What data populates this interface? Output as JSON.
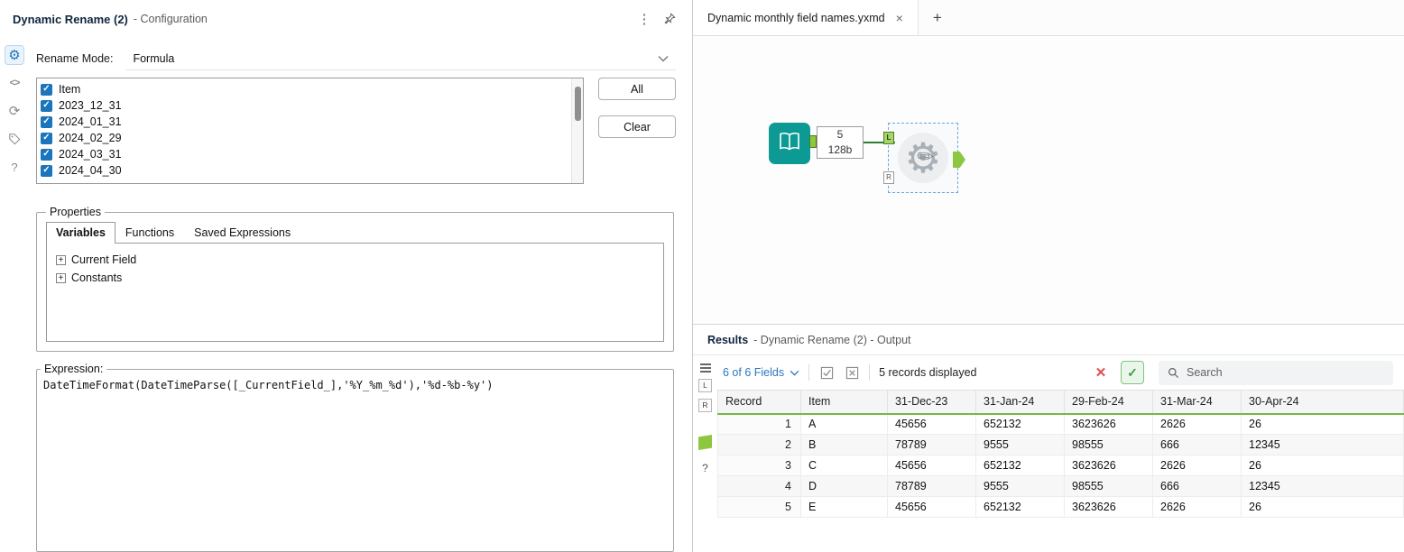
{
  "colors": {
    "accent_blue": "#1c74bc",
    "tool_teal": "#0e9a94",
    "anchor_green": "#8dc63f",
    "connection_green": "#2e7d32",
    "selection_blue": "#6aa7dd",
    "cancel_red": "#e04f4f",
    "run_green": "#3f9c44",
    "title_navy": "#10263f"
  },
  "config": {
    "title": "Dynamic Rename (2)",
    "subtitle": "- Configuration",
    "rename_mode": {
      "label": "Rename Mode:",
      "value": "Formula"
    },
    "fields": [
      "Item",
      "2023_12_31",
      "2024_01_31",
      "2024_02_29",
      "2024_03_31",
      "2024_04_30"
    ],
    "buttons": {
      "all": "All",
      "clear": "Clear"
    },
    "properties": {
      "legend": "Properties",
      "tabs": [
        "Variables",
        "Functions",
        "Saved Expressions"
      ],
      "active_tab": "Variables",
      "tree": [
        "Current Field",
        "Constants"
      ]
    },
    "expression": {
      "legend": "Expression:",
      "value": "DateTimeFormat(DateTimeParse([_CurrentField_],'%Y_%m_%d'),'%d-%b-%y')"
    }
  },
  "canvas": {
    "tab": {
      "title": "Dynamic monthly field names.yxmd"
    },
    "connection": {
      "count": "5",
      "size": "128b"
    },
    "anchors": {
      "left_top": "L",
      "left_bottom": "R"
    }
  },
  "results": {
    "title": "Results",
    "subtitle": "- Dynamic Rename (2) - Output",
    "fields_dropdown": "6 of 6 Fields",
    "records_text": "5 records displayed",
    "search_placeholder": "Search",
    "strip": {
      "left": "L",
      "right": "R"
    },
    "table": {
      "columns": [
        "Record",
        "Item",
        "31-Dec-23",
        "31-Jan-24",
        "29-Feb-24",
        "31-Mar-24",
        "30-Apr-24"
      ],
      "rows": [
        [
          "1",
          "A",
          "45656",
          "652132",
          "3623626",
          "2626",
          "26"
        ],
        [
          "2",
          "B",
          "78789",
          "9555",
          "98555",
          "666",
          "12345"
        ],
        [
          "3",
          "C",
          "45656",
          "652132",
          "3623626",
          "2626",
          "26"
        ],
        [
          "4",
          "D",
          "78789",
          "9555",
          "98555",
          "666",
          "12345"
        ],
        [
          "5",
          "E",
          "45656",
          "652132",
          "3623626",
          "2626",
          "26"
        ]
      ]
    }
  },
  "icons": {
    "menu_dots": "⋮",
    "gear": "⚙",
    "code": "<>",
    "refresh": "⟳",
    "question": "?",
    "close": "×",
    "plus": "+",
    "check": "✓",
    "cross": "✕",
    "pencil": "✎",
    "expander": "+"
  }
}
